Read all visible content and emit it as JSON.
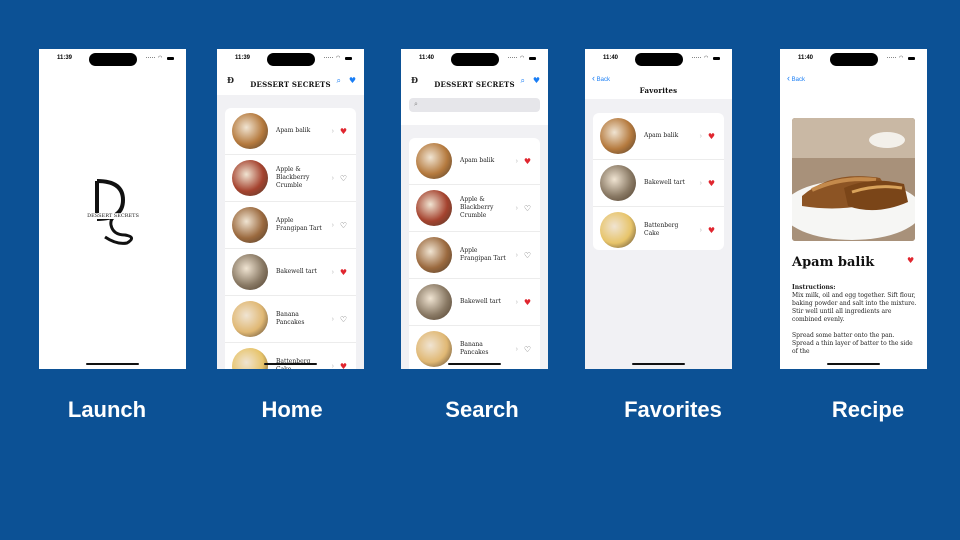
{
  "screens": {
    "launch": {
      "time": "11:39",
      "logo_letters": "DS",
      "logo_text": "DESSERT SECRETS",
      "caption": "Launch"
    },
    "home": {
      "time": "11:39",
      "title": "DESSERT SECRETS",
      "caption": "Home",
      "items": [
        {
          "label": "Apam balik",
          "fav": true,
          "color": "#b57a3e"
        },
        {
          "label": "Apple & Blackberry Crumble",
          "fav": false,
          "color": "#a5432f"
        },
        {
          "label": "Apple Frangipan Tart",
          "fav": false,
          "color": "#9b6a3f"
        },
        {
          "label": "Bakewell tart",
          "fav": true,
          "color": "#8a7a65"
        },
        {
          "label": "Banana Pancakes",
          "fav": false,
          "color": "#e0b874"
        },
        {
          "label": "Battenberg Cake",
          "fav": true,
          "color": "#e7c46a"
        }
      ]
    },
    "search": {
      "time": "11:40",
      "title": "DESSERT SECRETS",
      "caption": "Search",
      "items": [
        {
          "label": "Apam balik",
          "fav": true,
          "color": "#b57a3e"
        },
        {
          "label": "Apple & Blackberry Crumble",
          "fav": false,
          "color": "#a5432f"
        },
        {
          "label": "Apple Frangipan Tart",
          "fav": false,
          "color": "#9b6a3f"
        },
        {
          "label": "Bakewell tart",
          "fav": true,
          "color": "#8a7a65"
        },
        {
          "label": "Banana Pancakes",
          "fav": false,
          "color": "#e0b874"
        }
      ]
    },
    "favorites": {
      "time": "11:40",
      "back": "Back",
      "title": "Favorites",
      "caption": "Favorites",
      "items": [
        {
          "label": "Apam balik",
          "fav": true,
          "color": "#b57a3e"
        },
        {
          "label": "Bakewell tart",
          "fav": true,
          "color": "#8a7a65"
        },
        {
          "label": "Battenberg Cake",
          "fav": true,
          "color": "#e7c46a"
        }
      ]
    },
    "recipe": {
      "time": "11:40",
      "back": "Back",
      "title": "Apam balik",
      "instructions_heading": "Instructions:",
      "instructions_p1": "Mix milk, oil and egg together. Sift flour, baking powder and salt into the mixture. Stir well until all ingredients are combined evenly.",
      "instructions_p2": "Spread some batter onto the pan. Spread a thin layer of batter to the side of the",
      "caption": "Recipe"
    }
  },
  "icons": {
    "heart_filled": "♥",
    "heart_outline": "♡",
    "chevron": "›",
    "search": "⌕",
    "back_chevron": "‹"
  },
  "colors": {
    "background": "#0c5195",
    "accent": "#1a7ef5",
    "heart": "#e0262f"
  }
}
